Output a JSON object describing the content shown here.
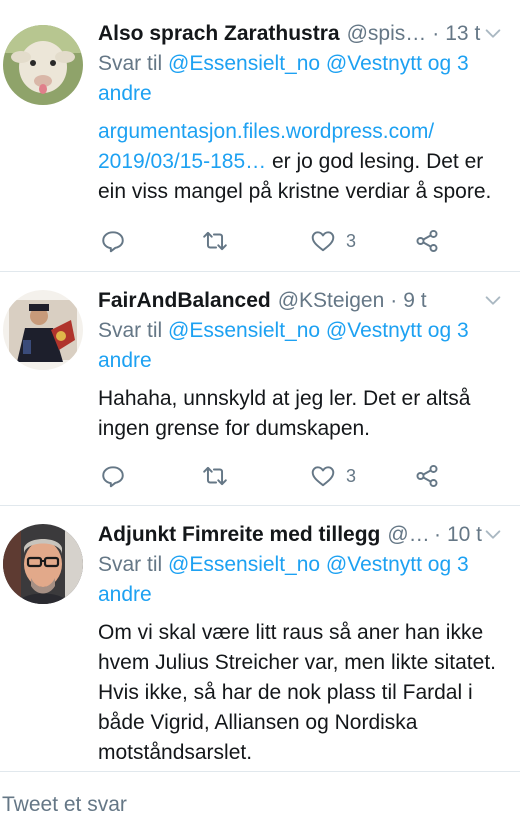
{
  "tweets": [
    {
      "name": "Also sprach Zarathustra",
      "handle": "@spis…",
      "time": "13 t",
      "reply_prefix": "Svar til ",
      "reply_mentions": "@Essensielt_no @Vestnytt og 3 andre",
      "link_text": "argumentasjon.files.wordpress.com/ 2019/03/15-185…",
      "body_text": " er jo god lesing. Det er ein viss mangel på kristne verdiar å spore.",
      "like_count": "3"
    },
    {
      "name": "FairAndBalanced",
      "handle": "@KSteigen",
      "time": "9 t",
      "reply_prefix": "Svar til ",
      "reply_mentions": "@Essensielt_no @Vestnytt og 3 andre",
      "body_text": "Hahaha, unnskyld at jeg ler. Det er altså ingen grense for dumskapen.",
      "like_count": "3"
    },
    {
      "name": "Adjunkt Fimreite med tillegg",
      "handle": "@…",
      "time": "10 t",
      "reply_prefix": "Svar til ",
      "reply_mentions": "@Essensielt_no @Vestnytt og 3 andre",
      "body_text": "Om vi skal være litt raus så aner han ikke hvem Julius Streicher var, men likte sitatet. Hvis ikke, så har de nok plass til Fardal i både Vigrid, Alliansen og Nordiska motståndsarslet."
    }
  ],
  "separator": "·",
  "reply_placeholder": "Tweet et svar",
  "icons": {
    "reply": "reply-icon",
    "retweet": "retweet-icon",
    "like": "heart-icon",
    "share": "share-icon",
    "menu": "chevron-down-icon"
  },
  "colors": {
    "link": "#1da1f2",
    "secondary_text": "#657786",
    "divider": "#e1e8ed"
  }
}
